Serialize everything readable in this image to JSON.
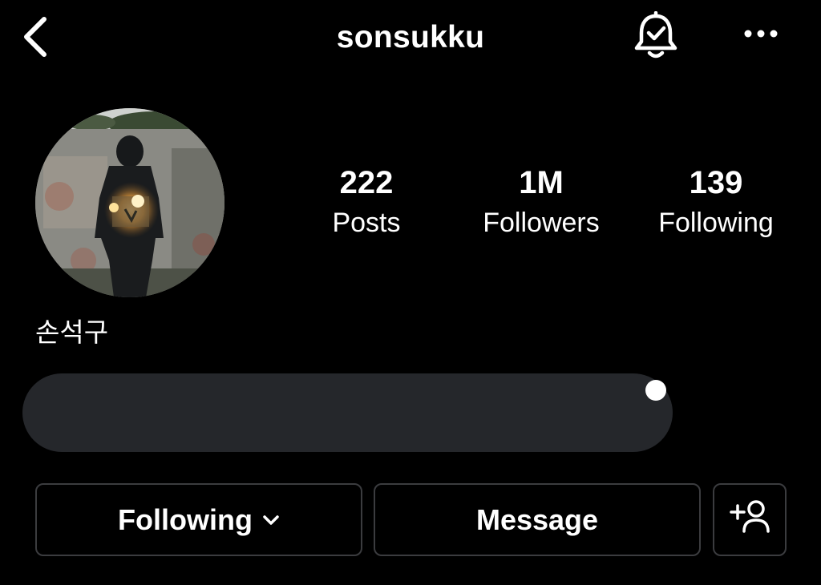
{
  "header": {
    "username": "sonsukku",
    "back_icon": "chevron-left-icon",
    "bell_icon": "bell-check-icon",
    "more_icon": "more-horizontal-icon"
  },
  "profile": {
    "display_name": "손석구",
    "bio": ""
  },
  "stats": [
    {
      "value": "222",
      "label": "Posts"
    },
    {
      "value": "1M",
      "label": "Followers"
    },
    {
      "value": "139",
      "label": "Following"
    }
  ],
  "actions": {
    "following_label": "Following",
    "message_label": "Message",
    "add_user_icon": "person-add-icon"
  },
  "colors": {
    "background": "#000000",
    "text": "#ffffff",
    "button_border": "#3b3c3f",
    "redaction": "#25272b"
  }
}
